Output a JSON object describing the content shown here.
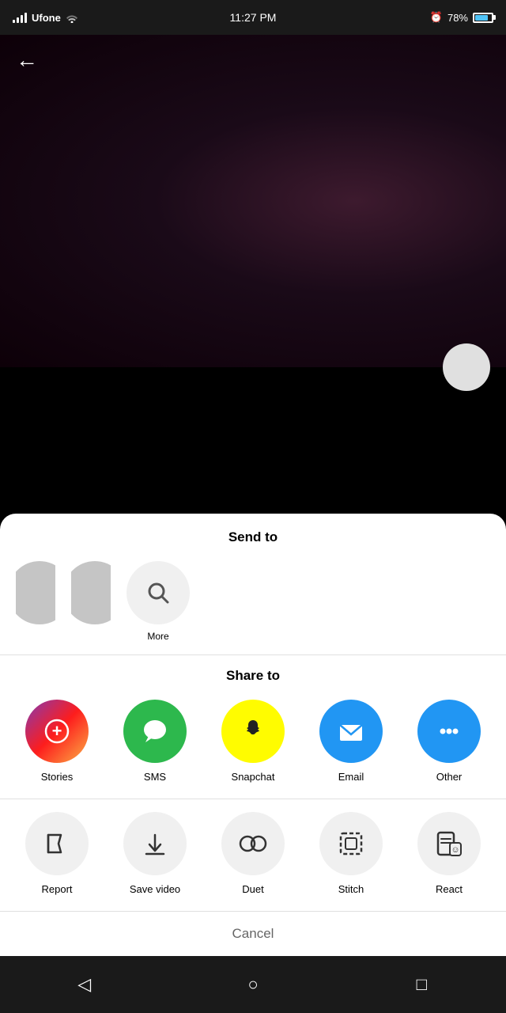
{
  "status": {
    "carrier": "Ufone",
    "time": "11:27 PM",
    "battery": "78%"
  },
  "back_button": "←",
  "send_to": {
    "title": "Send to",
    "more_label": "More"
  },
  "share_to": {
    "title": "Share to",
    "items": [
      {
        "id": "stories",
        "label": "Stories"
      },
      {
        "id": "sms",
        "label": "SMS"
      },
      {
        "id": "snapchat",
        "label": "Snapchat"
      },
      {
        "id": "email",
        "label": "Email"
      },
      {
        "id": "other",
        "label": "Other"
      }
    ]
  },
  "actions": {
    "items": [
      {
        "id": "report",
        "label": "Report"
      },
      {
        "id": "save_video",
        "label": "Save video"
      },
      {
        "id": "duet",
        "label": "Duet"
      },
      {
        "id": "stitch",
        "label": "Stitch"
      },
      {
        "id": "react",
        "label": "React"
      }
    ]
  },
  "cancel_label": "Cancel",
  "nav": {
    "back": "◁",
    "home": "○",
    "square": "□"
  }
}
